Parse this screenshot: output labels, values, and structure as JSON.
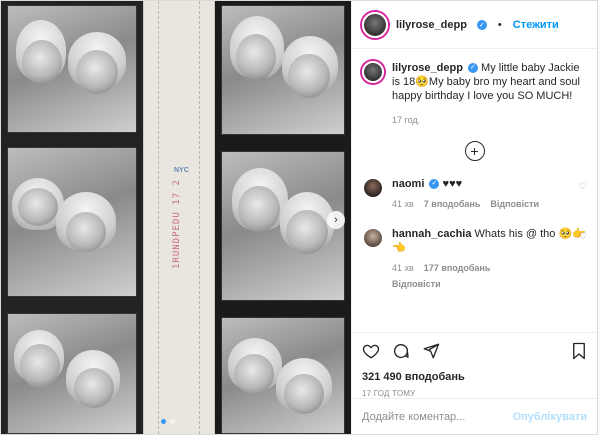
{
  "header": {
    "username": "lilyrose_depp",
    "separator": "•",
    "follow_label": "Стежити"
  },
  "caption": {
    "username": "lilyrose_depp",
    "text": "My little baby Jackie is 18🥺My baby bro my heart and soul happy birthday I love you SO MUCH!",
    "time": "17 год."
  },
  "comments": [
    {
      "username": "naomi",
      "text": "♥♥♥",
      "time": "41 хв",
      "likes": "7 вподобань",
      "reply": "Відповісти"
    },
    {
      "username": "hannah_cachia",
      "text": "Whats his @ tho 🥺👉👈",
      "time": "41 хв",
      "likes": "177 вподобань",
      "reply": "Відповісти"
    }
  ],
  "actions": {
    "likes": "321 490 вподобань",
    "ago": "17 ГОД ТОМУ"
  },
  "composer": {
    "placeholder": "Додайте коментар...",
    "publish_label": "Опублікувати"
  },
  "media": {
    "stamp_text": "NYC",
    "stamp_code": "1RUNDPEDU 17 2"
  },
  "colors": {
    "accent": "#0095f6",
    "verified": "#3897f0",
    "muted": "#8e8e8e"
  }
}
